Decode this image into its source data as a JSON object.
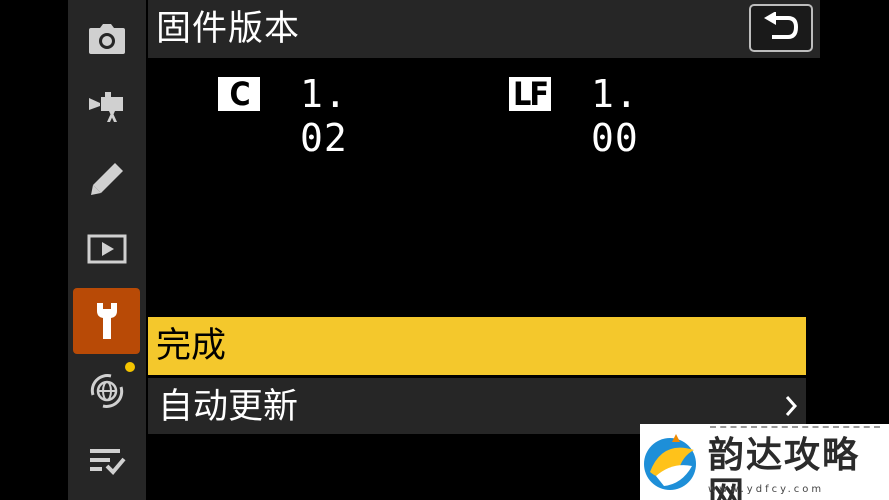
{
  "screen": {
    "title": "固件版本",
    "back_button": "return-arrow-icon"
  },
  "sidebar": {
    "items": [
      {
        "icon": "camera-icon"
      },
      {
        "icon": "movie-camera-icon"
      },
      {
        "icon": "pencil-icon"
      },
      {
        "icon": "playback-icon"
      },
      {
        "icon": "wrench-icon",
        "active": true
      },
      {
        "icon": "network-globe-icon",
        "notification": true
      },
      {
        "icon": "my-menu-icon"
      }
    ]
  },
  "firmware": [
    {
      "badge": "C",
      "version": "1. 02"
    },
    {
      "badge": "LF",
      "version": "1. 00"
    }
  ],
  "menu": {
    "items": [
      {
        "label": "完成",
        "selected": true
      },
      {
        "label": "自动更新",
        "has_submenu": true
      }
    ]
  },
  "watermark": {
    "text": "韵达攻略网",
    "url": "www.ydfcy.com"
  },
  "colors": {
    "accent_selected": "#f4c82c",
    "active_tab": "#b84a06",
    "panel": "#262626",
    "notification_dot": "#f4c400"
  }
}
